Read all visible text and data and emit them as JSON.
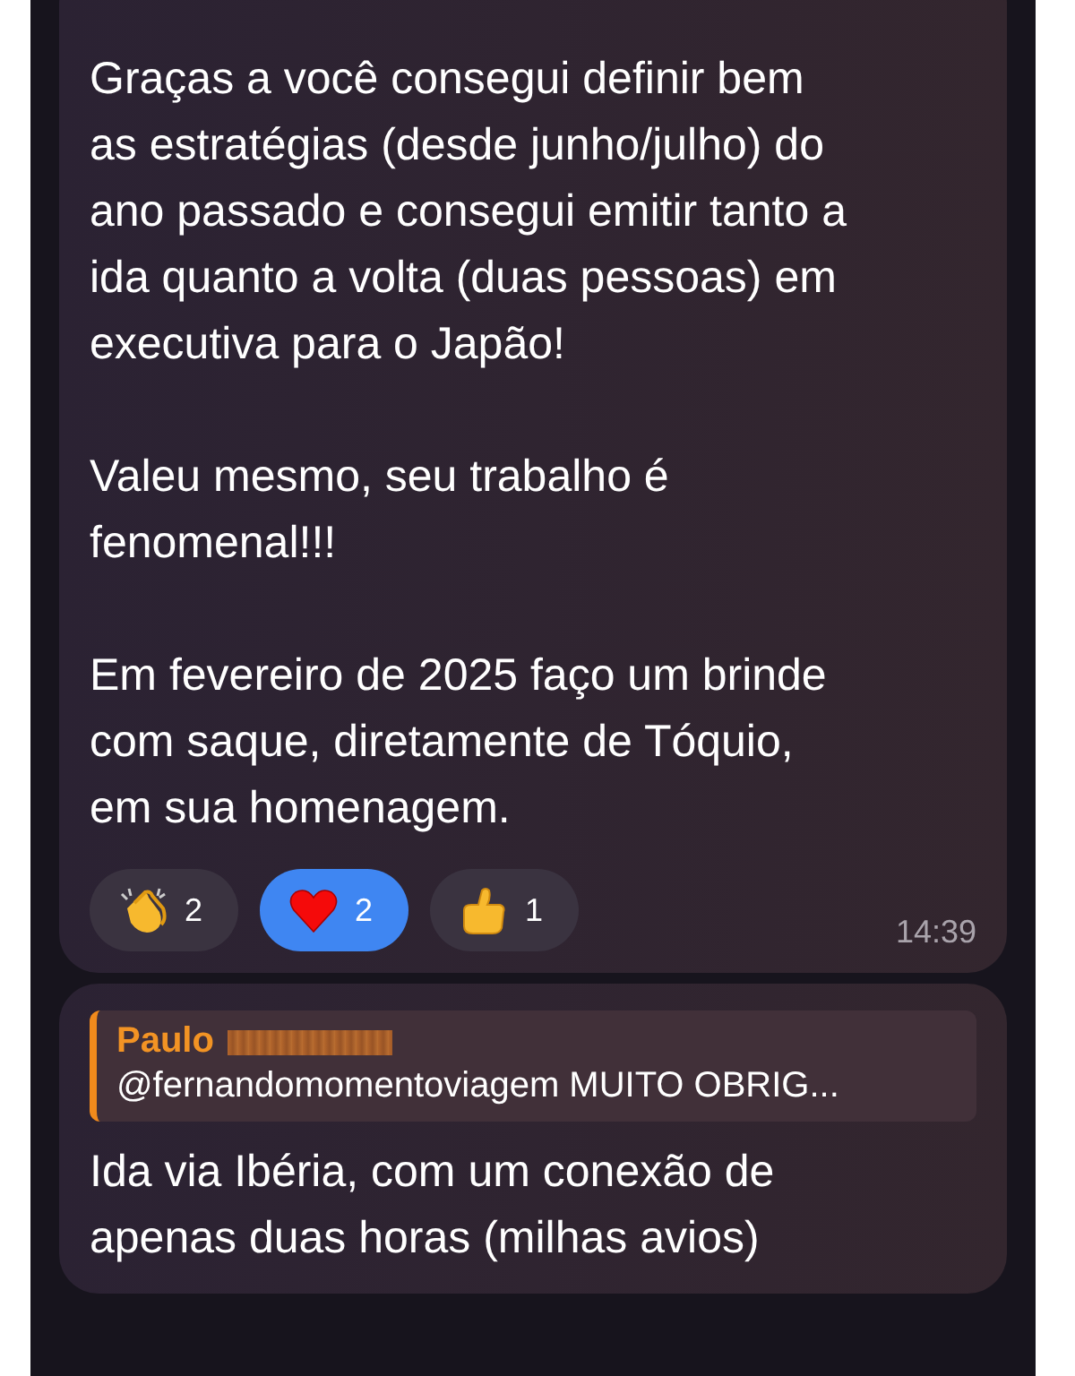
{
  "messages": [
    {
      "paragraphs": [
        [
          "Graças a você consegui definir bem",
          "as estratégias (desde junho/julho) do",
          "ano passado e consegui emitir tanto a",
          "ida quanto a volta (duas pessoas) em",
          "executiva para o Japão!"
        ],
        [
          "Valeu mesmo, seu trabalho é",
          "fenomenal!!!"
        ],
        [
          "Em fevereiro de 2025 faço um brinde",
          "com saque, diretamente de Tóquio,",
          "em sua homenagem."
        ]
      ],
      "reactions": [
        {
          "kind": "clap",
          "count": "2",
          "selected": false
        },
        {
          "kind": "heart",
          "count": "2",
          "selected": true
        },
        {
          "kind": "thumbs",
          "count": "1",
          "selected": false
        }
      ],
      "time": "14:39"
    },
    {
      "reply": {
        "author": "Paulo",
        "name_redacted": true,
        "quote": "@fernandomomentoviagem MUITO OBRIG..."
      },
      "paragraphs": [
        [
          "Ida via Ibéria, com um conexão de",
          "apenas duas horas (milhas avios)"
        ]
      ]
    }
  ]
}
